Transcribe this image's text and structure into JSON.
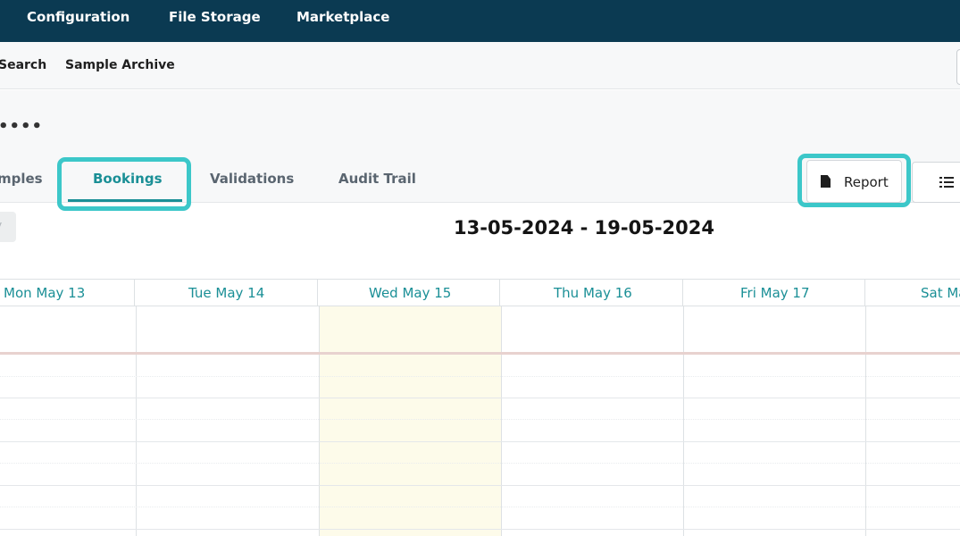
{
  "topnav": {
    "items": [
      "Configuration",
      "File Storage",
      "Marketplace"
    ]
  },
  "subnav": {
    "items": [
      "Search",
      "Sample Archive"
    ]
  },
  "header": {
    "ellipsis": "••••"
  },
  "tabs": {
    "items": [
      "mples",
      "Bookings",
      "Validations",
      "Audit Trail"
    ],
    "active": "Bookings"
  },
  "actions": {
    "report_label": "Report",
    "report_icon": "document-icon",
    "list_icon": "list-icon"
  },
  "calendar": {
    "date_range": "13-05-2024 - 19-05-2024",
    "days": [
      "Mon May 13",
      "Tue May 14",
      "Wed May 15",
      "Thu May 16",
      "Fri May 17",
      "Sat Ma"
    ],
    "today": "Wed May 15"
  },
  "colors": {
    "nav_bg": "#0b3a52",
    "accent": "#1a8f96",
    "highlight": "#3cc7c9",
    "today_bg": "#fdfbea"
  }
}
